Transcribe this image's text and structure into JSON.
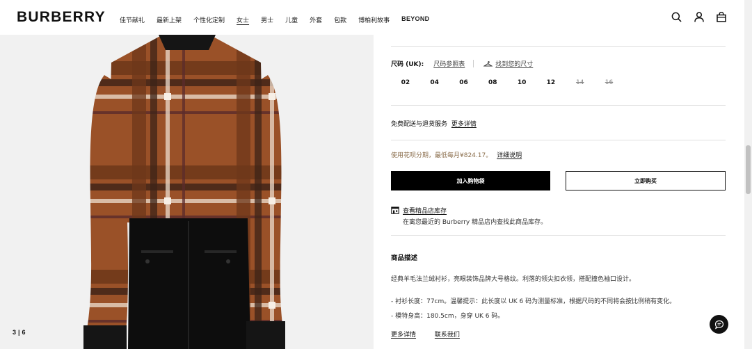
{
  "brand": "BURBERRY",
  "nav": [
    "佳节献礼",
    "最新上架",
    "个性化定制",
    "女士",
    "男士",
    "儿童",
    "外套",
    "包款",
    "博柏利故事",
    "BEYOND"
  ],
  "nav_active": "女士",
  "header_icons": [
    "search-icon",
    "account-icon",
    "bag-icon"
  ],
  "gallery": {
    "current": "3",
    "sep": "|",
    "total": "6"
  },
  "size": {
    "label": "尺码 (UK):",
    "guide": "尺码参照表",
    "find": "找到您的尺寸",
    "options": [
      {
        "value": "02",
        "available": true
      },
      {
        "value": "04",
        "available": true
      },
      {
        "value": "06",
        "available": true
      },
      {
        "value": "08",
        "available": true
      },
      {
        "value": "10",
        "available": true
      },
      {
        "value": "12",
        "available": true
      },
      {
        "value": "14",
        "available": false
      },
      {
        "value": "16",
        "available": false
      }
    ]
  },
  "delivery": {
    "text": "免费配送与退货服务",
    "link": "更多详情"
  },
  "installment": {
    "text": "使用花呗分期，最低每月¥824.17。",
    "link": "详细说明"
  },
  "buttons": {
    "add_to_bag": "加入购物袋",
    "buy_now": "立即购买"
  },
  "store": {
    "title": "查看精品店库存",
    "desc": "在离您最近的 Burberry 精品店内查找此商品库存。"
  },
  "description": {
    "title": "商品描述",
    "summary": "经典羊毛法兰绒衬衫，亮眼装饰品牌大号格纹。利落的领尖扣衣领，搭配撞色袖口设计。",
    "bullets": [
      "- 衬衫长度：77cm。温馨提示：此长度以 UK 6 码为测量标准，根据尺码的不同将会按比例稍有变化。",
      "- 模特身高：180.5cm，身穿 UK 6 码。"
    ],
    "more": "更多详情",
    "contact": "联系我们"
  },
  "colors": {
    "accent_text": "#8a6d4b",
    "button_dark": "#000000",
    "check_brown": "#8b4a22"
  }
}
